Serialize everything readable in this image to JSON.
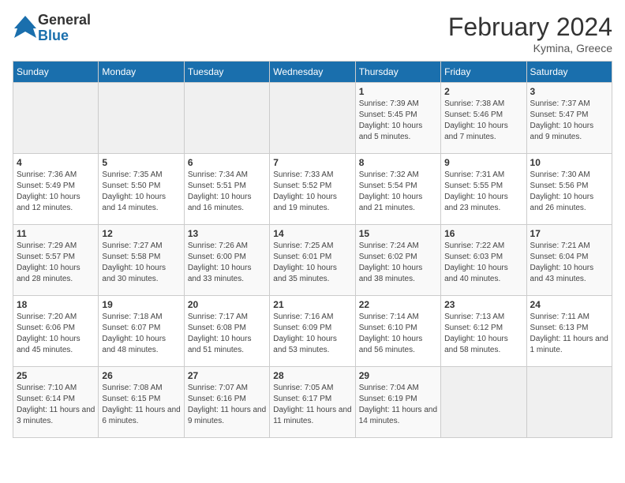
{
  "header": {
    "logo": {
      "general": "General",
      "blue": "Blue"
    },
    "title": "February 2024",
    "location": "Kymina, Greece"
  },
  "weekdays": [
    "Sunday",
    "Monday",
    "Tuesday",
    "Wednesday",
    "Thursday",
    "Friday",
    "Saturday"
  ],
  "weeks": [
    [
      {
        "day": "",
        "info": ""
      },
      {
        "day": "",
        "info": ""
      },
      {
        "day": "",
        "info": ""
      },
      {
        "day": "",
        "info": ""
      },
      {
        "day": "1",
        "info": "Sunrise: 7:39 AM\nSunset: 5:45 PM\nDaylight: 10 hours and 5 minutes."
      },
      {
        "day": "2",
        "info": "Sunrise: 7:38 AM\nSunset: 5:46 PM\nDaylight: 10 hours and 7 minutes."
      },
      {
        "day": "3",
        "info": "Sunrise: 7:37 AM\nSunset: 5:47 PM\nDaylight: 10 hours and 9 minutes."
      }
    ],
    [
      {
        "day": "4",
        "info": "Sunrise: 7:36 AM\nSunset: 5:49 PM\nDaylight: 10 hours and 12 minutes."
      },
      {
        "day": "5",
        "info": "Sunrise: 7:35 AM\nSunset: 5:50 PM\nDaylight: 10 hours and 14 minutes."
      },
      {
        "day": "6",
        "info": "Sunrise: 7:34 AM\nSunset: 5:51 PM\nDaylight: 10 hours and 16 minutes."
      },
      {
        "day": "7",
        "info": "Sunrise: 7:33 AM\nSunset: 5:52 PM\nDaylight: 10 hours and 19 minutes."
      },
      {
        "day": "8",
        "info": "Sunrise: 7:32 AM\nSunset: 5:54 PM\nDaylight: 10 hours and 21 minutes."
      },
      {
        "day": "9",
        "info": "Sunrise: 7:31 AM\nSunset: 5:55 PM\nDaylight: 10 hours and 23 minutes."
      },
      {
        "day": "10",
        "info": "Sunrise: 7:30 AM\nSunset: 5:56 PM\nDaylight: 10 hours and 26 minutes."
      }
    ],
    [
      {
        "day": "11",
        "info": "Sunrise: 7:29 AM\nSunset: 5:57 PM\nDaylight: 10 hours and 28 minutes."
      },
      {
        "day": "12",
        "info": "Sunrise: 7:27 AM\nSunset: 5:58 PM\nDaylight: 10 hours and 30 minutes."
      },
      {
        "day": "13",
        "info": "Sunrise: 7:26 AM\nSunset: 6:00 PM\nDaylight: 10 hours and 33 minutes."
      },
      {
        "day": "14",
        "info": "Sunrise: 7:25 AM\nSunset: 6:01 PM\nDaylight: 10 hours and 35 minutes."
      },
      {
        "day": "15",
        "info": "Sunrise: 7:24 AM\nSunset: 6:02 PM\nDaylight: 10 hours and 38 minutes."
      },
      {
        "day": "16",
        "info": "Sunrise: 7:22 AM\nSunset: 6:03 PM\nDaylight: 10 hours and 40 minutes."
      },
      {
        "day": "17",
        "info": "Sunrise: 7:21 AM\nSunset: 6:04 PM\nDaylight: 10 hours and 43 minutes."
      }
    ],
    [
      {
        "day": "18",
        "info": "Sunrise: 7:20 AM\nSunset: 6:06 PM\nDaylight: 10 hours and 45 minutes."
      },
      {
        "day": "19",
        "info": "Sunrise: 7:18 AM\nSunset: 6:07 PM\nDaylight: 10 hours and 48 minutes."
      },
      {
        "day": "20",
        "info": "Sunrise: 7:17 AM\nSunset: 6:08 PM\nDaylight: 10 hours and 51 minutes."
      },
      {
        "day": "21",
        "info": "Sunrise: 7:16 AM\nSunset: 6:09 PM\nDaylight: 10 hours and 53 minutes."
      },
      {
        "day": "22",
        "info": "Sunrise: 7:14 AM\nSunset: 6:10 PM\nDaylight: 10 hours and 56 minutes."
      },
      {
        "day": "23",
        "info": "Sunrise: 7:13 AM\nSunset: 6:12 PM\nDaylight: 10 hours and 58 minutes."
      },
      {
        "day": "24",
        "info": "Sunrise: 7:11 AM\nSunset: 6:13 PM\nDaylight: 11 hours and 1 minute."
      }
    ],
    [
      {
        "day": "25",
        "info": "Sunrise: 7:10 AM\nSunset: 6:14 PM\nDaylight: 11 hours and 3 minutes."
      },
      {
        "day": "26",
        "info": "Sunrise: 7:08 AM\nSunset: 6:15 PM\nDaylight: 11 hours and 6 minutes."
      },
      {
        "day": "27",
        "info": "Sunrise: 7:07 AM\nSunset: 6:16 PM\nDaylight: 11 hours and 9 minutes."
      },
      {
        "day": "28",
        "info": "Sunrise: 7:05 AM\nSunset: 6:17 PM\nDaylight: 11 hours and 11 minutes."
      },
      {
        "day": "29",
        "info": "Sunrise: 7:04 AM\nSunset: 6:19 PM\nDaylight: 11 hours and 14 minutes."
      },
      {
        "day": "",
        "info": ""
      },
      {
        "day": "",
        "info": ""
      }
    ]
  ]
}
